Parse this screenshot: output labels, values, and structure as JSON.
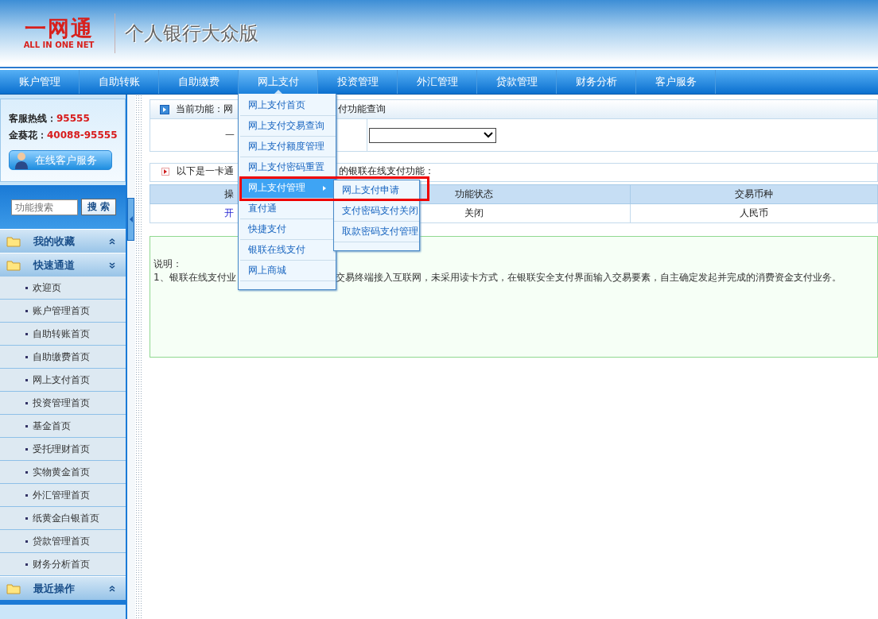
{
  "header": {
    "logo_cn": "一网通",
    "logo_en": "ALL IN ONE NET",
    "title": "个人银行大众版"
  },
  "nav": [
    {
      "label": "账户管理",
      "selected": false
    },
    {
      "label": "自助转账",
      "selected": false
    },
    {
      "label": "自助缴费",
      "selected": false
    },
    {
      "label": "网上支付",
      "selected": true
    },
    {
      "label": "投资管理",
      "selected": false
    },
    {
      "label": "外汇管理",
      "selected": false
    },
    {
      "label": "贷款管理",
      "selected": false
    },
    {
      "label": "财务分析",
      "selected": false
    },
    {
      "label": "客户服务",
      "selected": false
    }
  ],
  "sidebar": {
    "hotline_label": "客服热线：",
    "hotline": "95555",
    "vip_label": "金葵花：",
    "vip": "40088-95555",
    "service_button": "在线客户服务",
    "search": {
      "placeholder": "功能搜索",
      "button": "搜 索"
    },
    "sections": [
      {
        "title": "我的收藏",
        "expanded": false
      },
      {
        "title": "快速通道",
        "expanded": true,
        "items": [
          "欢迎页",
          "账户管理首页",
          "自助转账首页",
          "自助缴费首页",
          "网上支付首页",
          "投资管理首页",
          "基金首页",
          "受托理财首页",
          "实物黄金首页",
          "外汇管理首页",
          "纸黄金白银首页",
          "贷款管理首页",
          "财务分析首页"
        ]
      },
      {
        "title": "最近操作",
        "expanded": false
      }
    ]
  },
  "content": {
    "breadcrumb": {
      "label": "当前功能：",
      "start": "网",
      "end": "付功能查询"
    },
    "form": {
      "label": "一"
    },
    "info": {
      "start": "以下是一卡通",
      "end": "的银联在线支付功能："
    },
    "table": {
      "columns": [
        "操",
        "功能状态",
        "交易币种"
      ],
      "rows": [
        {
          "cells": [
            "开",
            "关闭",
            "人民币"
          ]
        }
      ]
    },
    "note": {
      "title": "说明：",
      "start": "1、银联在线支付业",
      "end": "交易终端接入互联网，未采用读卡方式，在银联安全支付界面输入交易要素，自主确定发起并完成的消费资金支付业务。"
    }
  },
  "menu": {
    "items": [
      {
        "label": "网上支付首页",
        "selected": false,
        "has_submenu": false
      },
      {
        "label": "网上支付交易查询",
        "selected": false,
        "has_submenu": false
      },
      {
        "label": "网上支付额度管理",
        "selected": false,
        "has_submenu": false
      },
      {
        "label": "网上支付密码重置",
        "selected": false,
        "has_submenu": false
      },
      {
        "label": "网上支付管理",
        "selected": true,
        "has_submenu": true
      },
      {
        "label": "直付通",
        "selected": false,
        "has_submenu": false
      },
      {
        "label": "快捷支付",
        "selected": false,
        "has_submenu": false
      },
      {
        "label": "银联在线支付",
        "selected": false,
        "has_submenu": false
      },
      {
        "label": "网上商城",
        "selected": false,
        "has_submenu": false
      }
    ],
    "submenu": [
      {
        "label": "网上支付申请",
        "annotated": true
      },
      {
        "label": "支付密码支付关闭",
        "annotated": false
      },
      {
        "label": "取款密码支付管理",
        "annotated": false
      }
    ]
  }
}
